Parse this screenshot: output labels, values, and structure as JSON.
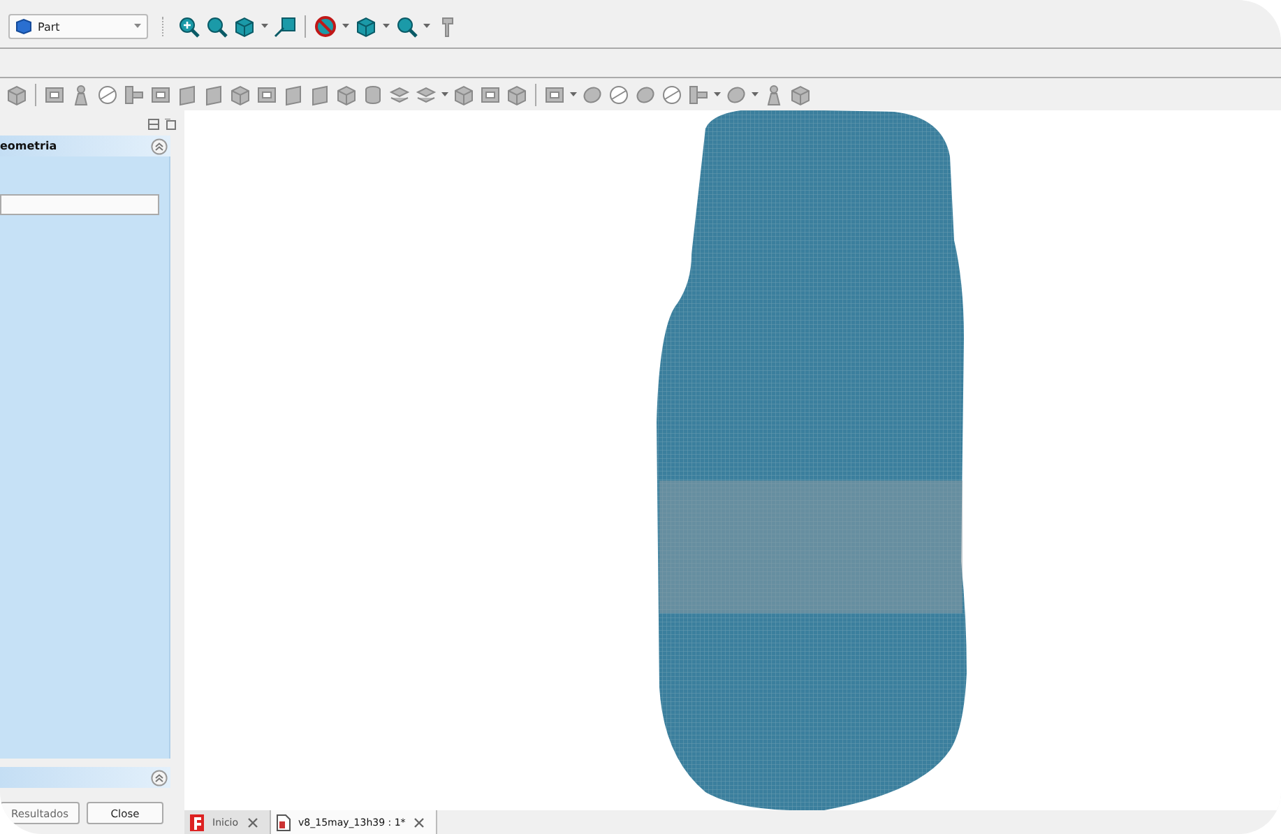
{
  "toolbar": {
    "workbench": "Part"
  },
  "task_panel": {
    "title": "eometria",
    "buttons": [
      "Resultados",
      "Close"
    ]
  },
  "document_tabs": [
    {
      "label": "Inicio",
      "selected": false
    },
    {
      "label": "v8_15may_13h39 : 1*",
      "selected": true
    }
  ]
}
